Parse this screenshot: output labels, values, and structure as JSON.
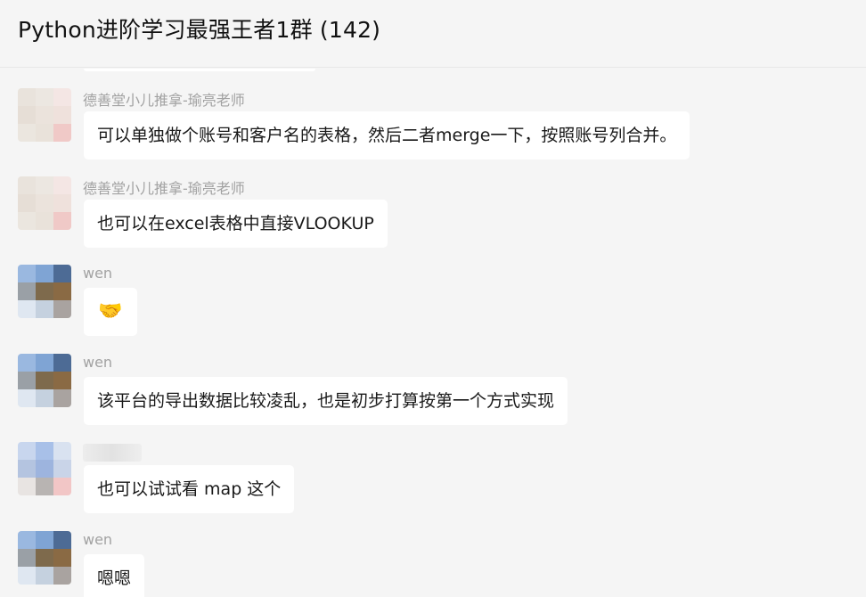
{
  "header": {
    "title": "Python进阶学习最强王者1群 (142)"
  },
  "messages": [
    {
      "sender": "德善堂小儿推拿-瑜亮老师",
      "text": "可以单独做个账号和客户名的表格，然后二者merge一下，按照账号列合并。"
    },
    {
      "sender": "德善堂小儿推拿-瑜亮老师",
      "text": "也可以在excel表格中直接VLOOKUP"
    },
    {
      "sender": "wen",
      "text": "🤝"
    },
    {
      "sender": "wen",
      "text": "该平台的导出数据比较凌乱，也是初步打算按第一个方式实现"
    },
    {
      "sender": "",
      "text": "也可以试试看 map 这个"
    },
    {
      "sender": "wen",
      "text": "嗯嗯"
    }
  ],
  "colors": {
    "background": "#f5f5f5",
    "bubble": "#ffffff",
    "sender_name": "#a2a2a2",
    "message_text": "#191919"
  }
}
